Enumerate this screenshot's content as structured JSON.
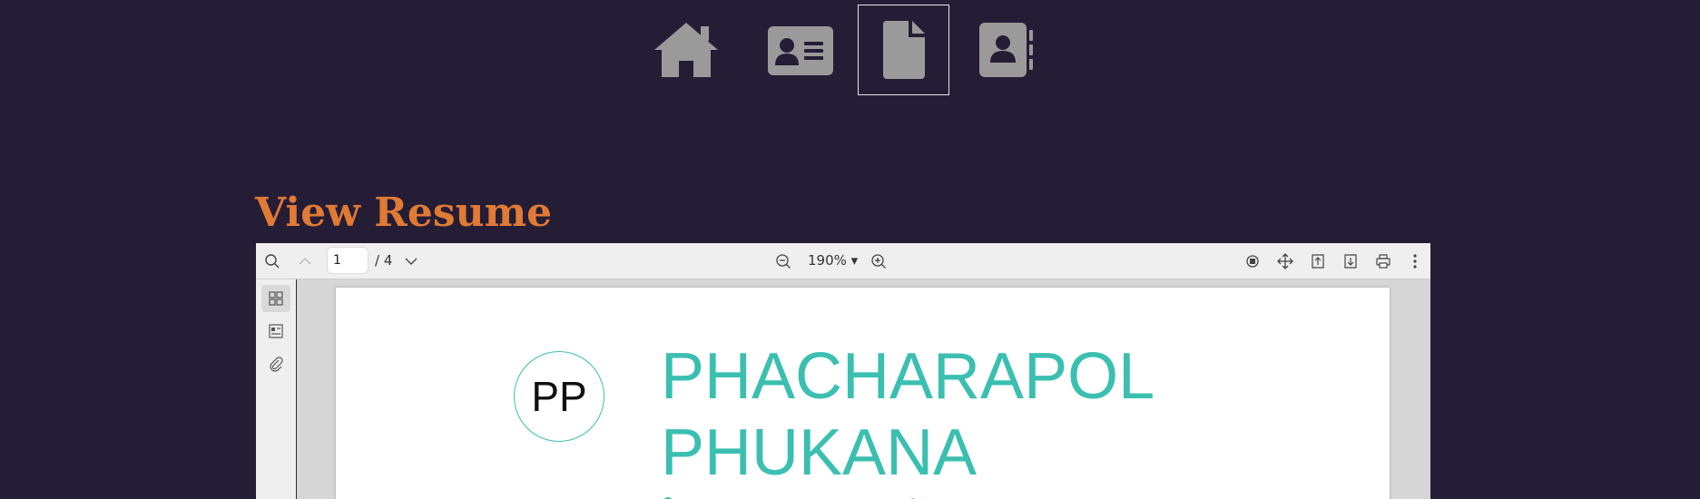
{
  "nav": {
    "items": [
      {
        "icon": "home-icon",
        "active": false
      },
      {
        "icon": "id-card-icon",
        "active": false
      },
      {
        "icon": "document-icon",
        "active": true
      },
      {
        "icon": "contact-book-icon",
        "active": false
      }
    ],
    "icon_color": "#9a9a9a"
  },
  "page": {
    "title": "View Resume",
    "title_color": "#e07a35",
    "background": "#251d35"
  },
  "pdf_viewer": {
    "toolbar": {
      "current_page": "1",
      "page_total": "/ 4",
      "zoom": "190% ▾"
    },
    "sidebar": {
      "items": [
        "thumbnails-icon",
        "outline-icon",
        "attachments-icon"
      ]
    },
    "document": {
      "avatar_initials": "PP",
      "name_line1": "PHACHARAPOL",
      "name_line2": "PHUKANA",
      "accent_color": "#3bbfb0"
    }
  }
}
